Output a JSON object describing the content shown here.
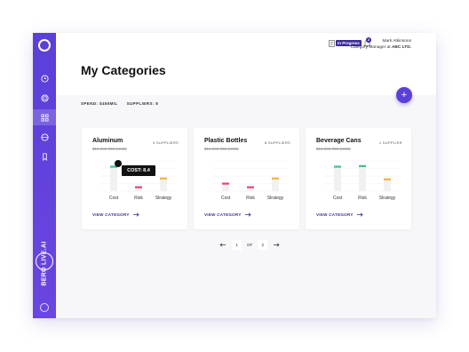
{
  "header": {
    "title": "My Categories",
    "status": "In Progress",
    "notifications": "2",
    "user_name": "Mark Atkinsons",
    "user_role_prefix": "Category Manager at",
    "user_company": "ABC LTD."
  },
  "summary": {
    "spend": "SPEND: $450MIL",
    "suppliers": "SUPPLIERS: 8"
  },
  "cards": [
    {
      "name": "Aluminum",
      "suppliers": "3 SUPPLIERS",
      "price": "$10 000 000 (USD)",
      "link": "VIEW CATEGORY",
      "chart_data": {
        "type": "bar",
        "categories": [
          "Cost",
          "Risk",
          "Strategy"
        ],
        "values": [
          8.4,
          1.6,
          4.5
        ],
        "ylim": [
          0,
          10
        ],
        "bar_colors": [
          "#3fbf9f",
          "#e8447a",
          "#f3b33d"
        ]
      }
    },
    {
      "name": "Plastic Bottles",
      "suppliers": "8 SUPPLIERS",
      "price": "$10 000 000 (USD)",
      "link": "VIEW CATEGORY",
      "chart_data": {
        "type": "bar",
        "categories": [
          "Cost",
          "Risk",
          "Strategy"
        ],
        "values": [
          2.8,
          1.6,
          4.5
        ],
        "ylim": [
          0,
          10
        ],
        "bar_colors": [
          "#e8447a",
          "#e8447a",
          "#f3b33d"
        ]
      }
    },
    {
      "name": "Beverage Cans",
      "suppliers": "1 SUPPLIER",
      "price": "$10 000 000 (USD)",
      "link": "VIEW CATEGORY",
      "chart_data": {
        "type": "bar",
        "categories": [
          "Cost",
          "Risk",
          "Strategy"
        ],
        "values": [
          8.4,
          8.6,
          4.2
        ],
        "ylim": [
          0,
          10
        ],
        "bar_colors": [
          "#3fbf9f",
          "#3fbf9f",
          "#f3b33d"
        ]
      }
    }
  ],
  "tooltip": "COST: 8.4",
  "pagination": {
    "current": "1",
    "of": "OF",
    "total": "2"
  },
  "brand": {
    "label": "BERO LIVE.AI"
  },
  "colors": {
    "accent": "#5b3fd8",
    "dark_accent": "#3b2a99"
  },
  "icons": {
    "sidebar": [
      "logo-icon",
      "clock-icon",
      "box-icon",
      "grid-icon",
      "globe-icon",
      "bookmark-icon",
      "info-icon"
    ],
    "header": [
      "document-icon",
      "bell-icon"
    ],
    "actions": [
      "plus-icon",
      "arrow-right-icon",
      "chevron-left-icon",
      "chevron-right-icon"
    ]
  }
}
